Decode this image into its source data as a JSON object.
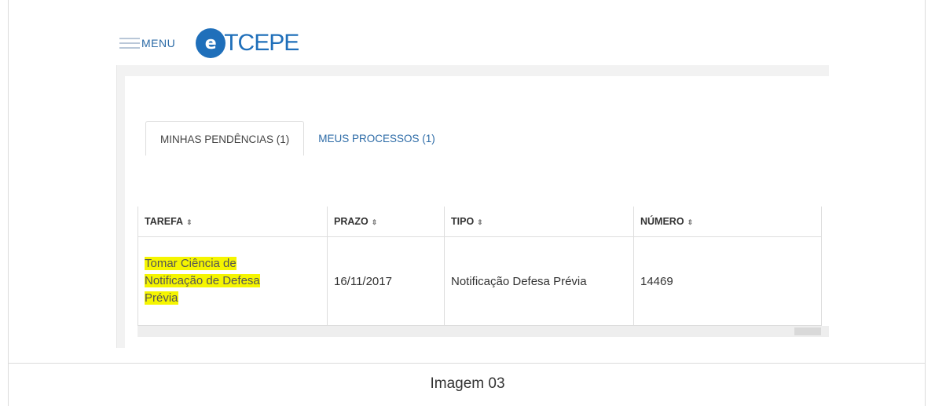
{
  "header": {
    "menu_label": "MENU",
    "logo_letter": "e",
    "logo_text": "TCEPE"
  },
  "tabs": [
    {
      "label": "MINHAS PENDÊNCIAS (1)",
      "active": true
    },
    {
      "label": "MEUS PROCESSOS (1)",
      "active": false
    }
  ],
  "table": {
    "sort_icon": "⇕",
    "columns": [
      "TAREFA",
      "PRAZO",
      "TIPO",
      "NÚMERO"
    ],
    "rows": [
      {
        "tarefa_lines": [
          "Tomar Ciência de",
          "Notificação de Defesa",
          "Prévia"
        ],
        "prazo": "16/11/2017",
        "tipo": "Notificação Defesa Prévia",
        "numero": "14469"
      }
    ]
  },
  "caption": "Imagem 03",
  "colors": {
    "brand": "#1f6fba",
    "link": "#2b6aa6",
    "highlight": "#f5f500"
  }
}
